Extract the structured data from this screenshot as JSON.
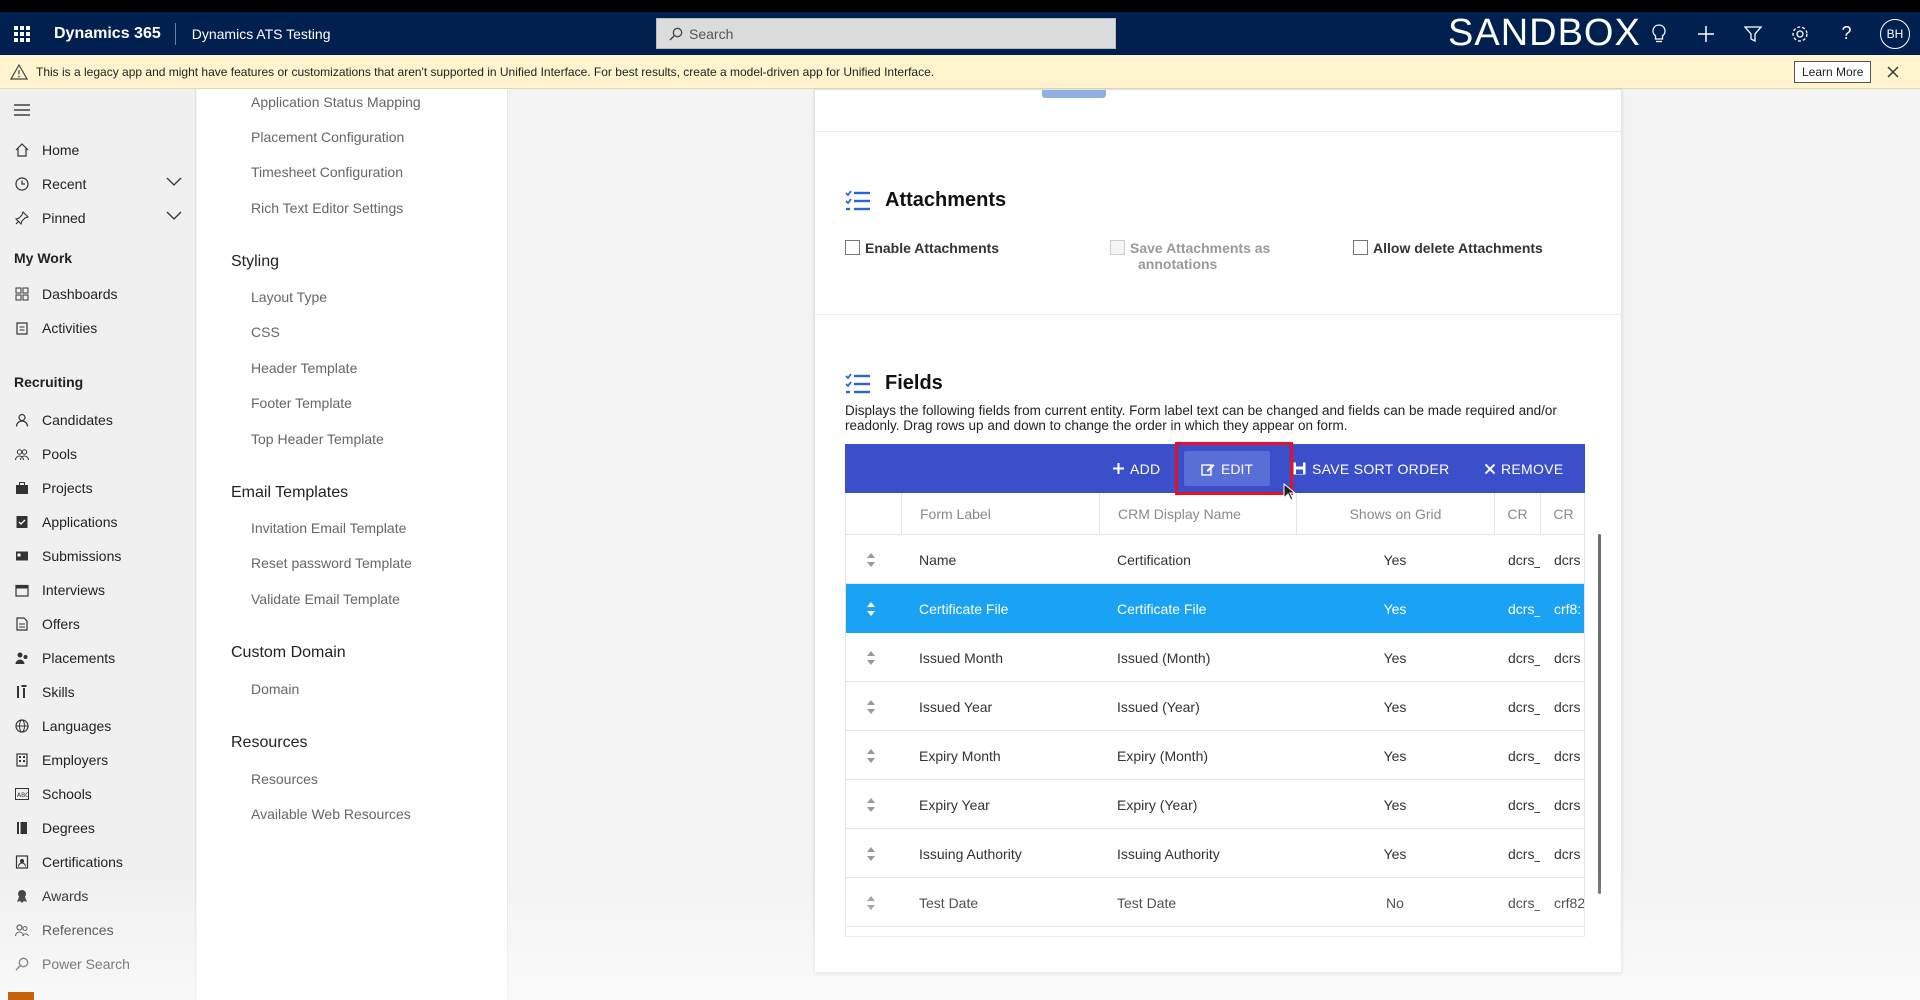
{
  "header": {
    "brand": "Dynamics 365",
    "app_name": "Dynamics ATS Testing",
    "search_placeholder": "Search",
    "environment": "SANDBOX",
    "user_initials": "BH"
  },
  "banner": {
    "message": "This is a legacy app and might have features or customizations that aren't supported in Unified Interface. For best results, create a model-driven app for Unified Interface.",
    "learn_more": "Learn More"
  },
  "leftnav": {
    "home": "Home",
    "recent": "Recent",
    "pinned": "Pinned",
    "my_work_title": "My Work",
    "dashboards": "Dashboards",
    "activities": "Activities",
    "recruiting_title": "Recruiting",
    "recruiting_items": [
      "Candidates",
      "Pools",
      "Projects",
      "Applications",
      "Submissions",
      "Interviews",
      "Offers",
      "Placements",
      "Skills",
      "Languages",
      "Employers",
      "Schools",
      "Degrees",
      "Certifications",
      "Awards",
      "References",
      "Power Search"
    ]
  },
  "settings": {
    "top_items": [
      "Application Status Mapping",
      "Placement Configuration",
      "Timesheet Configuration",
      "Rich Text Editor Settings"
    ],
    "styling_title": "Styling",
    "styling_items": [
      "Layout Type",
      "CSS",
      "Header Template",
      "Footer Template",
      "Top Header Template"
    ],
    "email_title": "Email Templates",
    "email_items": [
      "Invitation Email Template",
      "Reset password Template",
      "Validate Email Template"
    ],
    "domain_title": "Custom Domain",
    "domain_items": [
      "Domain"
    ],
    "resources_title": "Resources",
    "resources_items": [
      "Resources",
      "Available Web Resources"
    ]
  },
  "attachments": {
    "title": "Attachments",
    "enable": "Enable Attachments",
    "save_as_annotations_line1": "Save Attachments as",
    "save_as_annotations_line2": "annotations",
    "allow_delete": "Allow delete Attachments"
  },
  "fields": {
    "title": "Fields",
    "description": "Displays the following fields from current entity. Form label text can be changed and fields can be made required and/or readonly. Drag rows up and down to change the order in which they appear on form.",
    "toolbar": {
      "add": "ADD",
      "edit": "EDIT",
      "save_sort_order": "SAVE SORT ORDER",
      "remove": "REMOVE"
    },
    "columns": [
      "Form Label",
      "CRM Display Name",
      "Shows on Grid",
      "CR",
      "CR"
    ],
    "rows": [
      {
        "label": "Name",
        "crm": "Certification",
        "grid": "Yes",
        "c4": "dcrs_",
        "c5": "dcrs"
      },
      {
        "label": "Certificate File",
        "crm": "Certificate File",
        "grid": "Yes",
        "c4": "dcrs_",
        "c5": "crf8:"
      },
      {
        "label": "Issued Month",
        "crm": "Issued (Month)",
        "grid": "Yes",
        "c4": "dcrs_",
        "c5": "dcrs"
      },
      {
        "label": "Issued Year",
        "crm": "Issued (Year)",
        "grid": "Yes",
        "c4": "dcrs_",
        "c5": "dcrs"
      },
      {
        "label": "Expiry Month",
        "crm": "Expiry (Month)",
        "grid": "Yes",
        "c4": "dcrs_",
        "c5": "dcrs"
      },
      {
        "label": "Expiry Year",
        "crm": "Expiry (Year)",
        "grid": "Yes",
        "c4": "dcrs_",
        "c5": "dcrs"
      },
      {
        "label": "Issuing Authority",
        "crm": "Issuing Authority",
        "grid": "Yes",
        "c4": "dcrs_",
        "c5": "dcrs"
      },
      {
        "label": "Test Date",
        "crm": "Test Date",
        "grid": "No",
        "c4": "dcrs_",
        "c5": "crf82"
      }
    ]
  }
}
